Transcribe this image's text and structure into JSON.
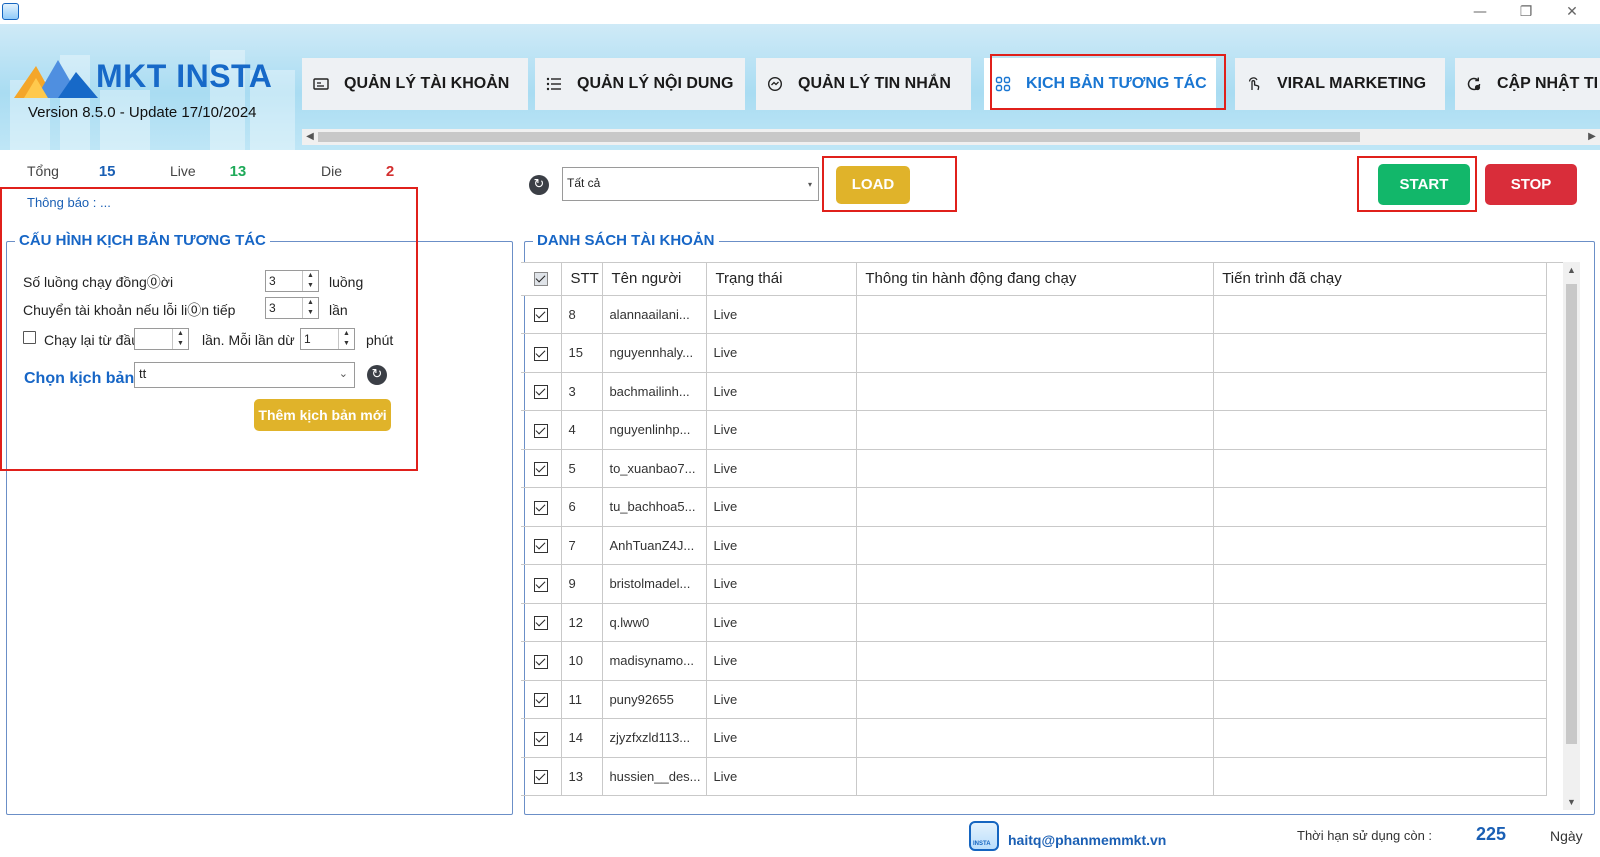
{
  "app": {
    "logo_text": "MKT INSTA",
    "version": "Version  8.5.0  -  Update 17/10/2024"
  },
  "window_controls": {
    "minimize": "—",
    "restore": "❐",
    "close": "✕"
  },
  "tabs": [
    {
      "label": "QUẢN LÝ TÀI KHOẢN",
      "icon": "id-card-icon"
    },
    {
      "label": "QUẢN LÝ NỘI DUNG",
      "icon": "list-icon"
    },
    {
      "label": "QUẢN LÝ TIN NHẮN",
      "icon": "chat-icon"
    },
    {
      "label": "KỊCH BẢN TƯƠNG TÁC",
      "icon": "grid-icon",
      "active": true
    },
    {
      "label": "VIRAL MARKETING",
      "icon": "touch-icon"
    },
    {
      "label": "CẬP NHẬT TI",
      "icon": "update-icon"
    }
  ],
  "stats": {
    "total_label": "Tổng",
    "total_value": "15",
    "live_label": "Live",
    "live_value": "13",
    "die_label": "Die",
    "die_value": "2"
  },
  "notice": "Thông báo : ...",
  "config": {
    "title": "CẤU HÌNH KỊCH BẢN TƯƠNG TÁC",
    "threads_label": "Số luồng chạy đồng⓪ời",
    "threads_value": "3",
    "threads_unit": "luồng",
    "switch_label": "Chuyển tài khoản nếu lỗi li⓪n tiếp",
    "switch_value": "3",
    "switch_unit": "lần",
    "rerun_label": "Chạy lại từ đầu",
    "rerun_value": "",
    "rerun_mid": "lần. Mỗi lần dừ",
    "pause_value": "1",
    "pause_unit": "phút",
    "script_label": "Chọn kịch bản",
    "script_value": "tt",
    "add_button": "Thêm kịch bản mới"
  },
  "filter": {
    "value": "Tất cả",
    "load_button": "LOAD"
  },
  "actions": {
    "start": "START",
    "stop": "STOP"
  },
  "accounts": {
    "title": "DANH SÁCH TÀI KHOẢN",
    "columns": [
      "STT",
      "Tên người",
      "Trạng thái",
      "Thông tin hành động đang chạy",
      "Tiến trình đã chạy"
    ],
    "rows": [
      {
        "stt": "8",
        "name": "alannaailani...",
        "status": "Live"
      },
      {
        "stt": "15",
        "name": "nguyennhaly...",
        "status": "Live"
      },
      {
        "stt": "3",
        "name": "bachmailinh...",
        "status": "Live"
      },
      {
        "stt": "4",
        "name": "nguyenlinhp...",
        "status": "Live"
      },
      {
        "stt": "5",
        "name": "to_xuanbao7...",
        "status": "Live"
      },
      {
        "stt": "6",
        "name": "tu_bachhoa5...",
        "status": "Live"
      },
      {
        "stt": "7",
        "name": "AnhTuanZ4J...",
        "status": "Live"
      },
      {
        "stt": "9",
        "name": "bristolmadel...",
        "status": "Live"
      },
      {
        "stt": "12",
        "name": "q.lww0",
        "status": "Live"
      },
      {
        "stt": "10",
        "name": "madisynamo...",
        "status": "Live"
      },
      {
        "stt": "11",
        "name": "puny92655",
        "status": "Live"
      },
      {
        "stt": "14",
        "name": "zjyzfxzld113...",
        "status": "Live"
      },
      {
        "stt": "13",
        "name": "hussien__des...",
        "status": "Live"
      }
    ]
  },
  "footer": {
    "logo_text": "INSTA",
    "email": "haitq@phanmemmkt.vn",
    "days_label": "Thời hạn sử dụng còn :",
    "days_value": "225",
    "days_unit": "Ngày"
  },
  "colors": {
    "accent": "#1976d2",
    "live": "#1faa59",
    "die": "#d32f2f",
    "load": "#e0b32a",
    "start": "#12b76a",
    "stop": "#d92d3a",
    "highlight": "#e0201b"
  }
}
